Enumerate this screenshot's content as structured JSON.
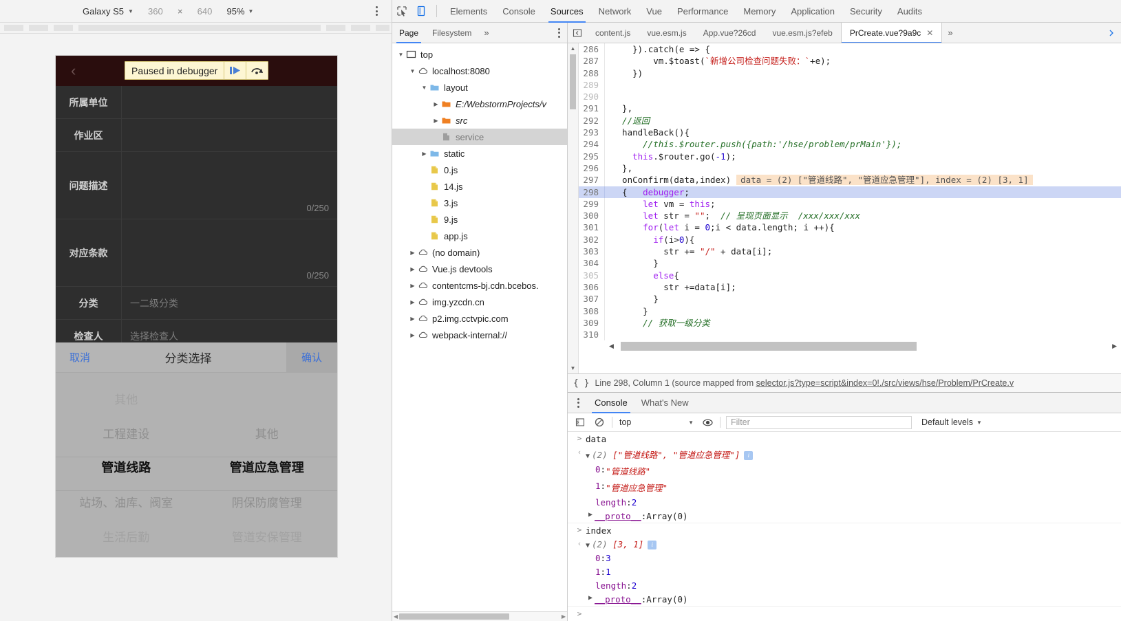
{
  "device_toolbar": {
    "device_name": "Galaxy S5",
    "width": "360",
    "dim_separator": "×",
    "height": "640",
    "zoom": "95%",
    "more_options_icon": "kebab-menu-icon"
  },
  "phone": {
    "back_icon": "back-chevron-icon",
    "paused_banner": {
      "text": "Paused in debugger",
      "resume_icon": "resume-script-icon",
      "step_over_icon": "step-over-icon"
    },
    "form_rows": [
      {
        "label": "所属单位",
        "value": "",
        "counter": ""
      },
      {
        "label": "作业区",
        "value": "",
        "counter": ""
      },
      {
        "label": "问题描述",
        "value": "",
        "counter": "0/250"
      },
      {
        "label": "对应条款",
        "value": "",
        "counter": "0/250"
      },
      {
        "label": "分类",
        "value": "一二级分类",
        "counter": ""
      },
      {
        "label": "检查人",
        "value": "选择检查人",
        "counter": ""
      }
    ],
    "picker": {
      "cancel": "取消",
      "title": "分类选择",
      "confirm": "确认",
      "column_left": [
        {
          "text": "其他",
          "state": "faded"
        },
        {
          "text": "工程建设",
          "state": "normal"
        },
        {
          "text": "管道线路",
          "state": "selected"
        },
        {
          "text": "站场、油库、阀室",
          "state": "normal"
        },
        {
          "text": "生活后勤",
          "state": "faded"
        }
      ],
      "column_right": [
        {
          "text": "",
          "state": "faded"
        },
        {
          "text": "其他",
          "state": "normal"
        },
        {
          "text": "管道应急管理",
          "state": "selected"
        },
        {
          "text": "阴保防腐管理",
          "state": "normal"
        },
        {
          "text": "管道安保管理",
          "state": "faded"
        }
      ]
    }
  },
  "devtools": {
    "inspect_icon": "inspect-element-icon",
    "device_toggle_icon": "toggle-device-toolbar-icon",
    "tabs": [
      {
        "label": "Elements",
        "active": false
      },
      {
        "label": "Console",
        "active": false
      },
      {
        "label": "Sources",
        "active": true
      },
      {
        "label": "Network",
        "active": false
      },
      {
        "label": "Vue",
        "active": false
      },
      {
        "label": "Performance",
        "active": false
      },
      {
        "label": "Memory",
        "active": false
      },
      {
        "label": "Application",
        "active": false
      },
      {
        "label": "Security",
        "active": false
      },
      {
        "label": "Audits",
        "active": false
      }
    ]
  },
  "navigator": {
    "tabs": [
      {
        "label": "Page",
        "active": true
      },
      {
        "label": "Filesystem",
        "active": false
      }
    ],
    "more_icon": "more-tabs-chevron-icon",
    "kebab_icon": "navigator-menu-icon",
    "tree": [
      {
        "indent": 0,
        "twisty": "▼",
        "icon": "frame-icon",
        "label": "top",
        "style": "normal",
        "selected": false
      },
      {
        "indent": 1,
        "twisty": "▼",
        "icon": "cloud-icon",
        "label": "localhost:8080",
        "style": "normal",
        "selected": false
      },
      {
        "indent": 2,
        "twisty": "▼",
        "icon": "folder-blue-icon",
        "label": "layout",
        "style": "normal",
        "selected": false
      },
      {
        "indent": 3,
        "twisty": "▶",
        "icon": "folder-orange-icon",
        "label": "E:/WebstormProjects/v",
        "style": "italic",
        "selected": false
      },
      {
        "indent": 3,
        "twisty": "▶",
        "icon": "folder-orange-icon",
        "label": "src",
        "style": "italic",
        "selected": false
      },
      {
        "indent": 3,
        "twisty": "",
        "icon": "file-gray-icon",
        "label": "service",
        "style": "dim",
        "selected": true
      },
      {
        "indent": 2,
        "twisty": "▶",
        "icon": "folder-blue-icon",
        "label": "static",
        "style": "normal",
        "selected": false
      },
      {
        "indent": 2,
        "twisty": "",
        "icon": "file-js-icon",
        "label": "0.js",
        "style": "normal",
        "selected": false
      },
      {
        "indent": 2,
        "twisty": "",
        "icon": "file-js-icon",
        "label": "14.js",
        "style": "normal",
        "selected": false
      },
      {
        "indent": 2,
        "twisty": "",
        "icon": "file-js-icon",
        "label": "3.js",
        "style": "normal",
        "selected": false
      },
      {
        "indent": 2,
        "twisty": "",
        "icon": "file-js-icon",
        "label": "9.js",
        "style": "normal",
        "selected": false
      },
      {
        "indent": 2,
        "twisty": "",
        "icon": "file-js-icon",
        "label": "app.js",
        "style": "normal",
        "selected": false
      },
      {
        "indent": 1,
        "twisty": "▶",
        "icon": "cloud-icon",
        "label": "(no domain)",
        "style": "normal",
        "selected": false
      },
      {
        "indent": 1,
        "twisty": "▶",
        "icon": "cloud-icon",
        "label": "Vue.js devtools",
        "style": "normal",
        "selected": false
      },
      {
        "indent": 1,
        "twisty": "▶",
        "icon": "cloud-icon",
        "label": "contentcms-bj.cdn.bcebos.",
        "style": "normal",
        "selected": false
      },
      {
        "indent": 1,
        "twisty": "▶",
        "icon": "cloud-icon",
        "label": "img.yzcdn.cn",
        "style": "normal",
        "selected": false
      },
      {
        "indent": 1,
        "twisty": "▶",
        "icon": "cloud-icon",
        "label": "p2.img.cctvpic.com",
        "style": "normal",
        "selected": false
      },
      {
        "indent": 1,
        "twisty": "▶",
        "icon": "cloud-icon",
        "label": "webpack-internal://",
        "style": "normal",
        "selected": false
      }
    ]
  },
  "file_tabs": {
    "panel_icon": "show-navigator-icon",
    "items": [
      {
        "label": "content.js",
        "active": false,
        "closable": false
      },
      {
        "label": "vue.esm.js",
        "active": false,
        "closable": false
      },
      {
        "label": "App.vue?26cd",
        "active": false,
        "closable": false
      },
      {
        "label": "vue.esm.js?efeb",
        "active": false,
        "closable": false
      },
      {
        "label": "PrCreate.vue?9a9c",
        "active": true,
        "closable": true
      }
    ],
    "close_icon": "close-tab-icon",
    "overflow_icon": "more-tabs-icon"
  },
  "editor": {
    "inline_value": "data = (2) [\"管道线路\", \"管道应急管理\"], index = (2) [3, 1]",
    "lines": [
      {
        "num": "286",
        "dim": false,
        "hl": false,
        "tokens": [
          {
            "t": "p",
            "v": "    })."
          },
          {
            "t": "f",
            "v": "catch"
          },
          {
            "t": "p",
            "v": "(e => {"
          }
        ]
      },
      {
        "num": "287",
        "dim": false,
        "hl": false,
        "tokens": [
          {
            "t": "p",
            "v": "        vm."
          },
          {
            "t": "f",
            "v": "$toast"
          },
          {
            "t": "p",
            "v": "("
          },
          {
            "t": "s",
            "v": "`新增公司检查问题失败：`"
          },
          {
            "t": "p",
            "v": "+e);"
          }
        ]
      },
      {
        "num": "288",
        "dim": false,
        "hl": false,
        "tokens": [
          {
            "t": "p",
            "v": "    })"
          }
        ]
      },
      {
        "num": "289",
        "dim": true,
        "hl": false,
        "tokens": []
      },
      {
        "num": "290",
        "dim": true,
        "hl": false,
        "tokens": []
      },
      {
        "num": "291",
        "dim": false,
        "hl": false,
        "tokens": [
          {
            "t": "p",
            "v": "  },"
          }
        ]
      },
      {
        "num": "292",
        "dim": false,
        "hl": false,
        "tokens": [
          {
            "t": "c",
            "v": "  //返回"
          }
        ]
      },
      {
        "num": "293",
        "dim": false,
        "hl": false,
        "tokens": [
          {
            "t": "f",
            "v": "  handleBack"
          },
          {
            "t": "p",
            "v": "(){"
          }
        ]
      },
      {
        "num": "294",
        "dim": false,
        "hl": false,
        "tokens": [
          {
            "t": "c",
            "v": "      //this.$router.push({path:'/hse/problem/prMain'});"
          }
        ]
      },
      {
        "num": "295",
        "dim": false,
        "hl": false,
        "tokens": [
          {
            "t": "k",
            "v": "    this"
          },
          {
            "t": "p",
            "v": ".$router."
          },
          {
            "t": "f",
            "v": "go"
          },
          {
            "t": "p",
            "v": "("
          },
          {
            "t": "n",
            "v": "-1"
          },
          {
            "t": "p",
            "v": ");"
          }
        ]
      },
      {
        "num": "296",
        "dim": false,
        "hl": false,
        "tokens": [
          {
            "t": "p",
            "v": "  },"
          }
        ]
      },
      {
        "num": "297",
        "dim": false,
        "hl": false,
        "inline": true,
        "tokens": [
          {
            "t": "f",
            "v": "  onConfirm"
          },
          {
            "t": "p",
            "v": "(data,index)"
          }
        ]
      },
      {
        "num": "298",
        "dim": false,
        "hl": true,
        "tokens": [
          {
            "t": "p",
            "v": "  {   "
          },
          {
            "t": "k",
            "v": "debugger"
          },
          {
            "t": "p",
            "v": ";"
          }
        ]
      },
      {
        "num": "299",
        "dim": false,
        "hl": false,
        "tokens": [
          {
            "t": "k",
            "v": "      let"
          },
          {
            "t": "p",
            "v": " vm = "
          },
          {
            "t": "k",
            "v": "this"
          },
          {
            "t": "p",
            "v": ";"
          }
        ]
      },
      {
        "num": "300",
        "dim": false,
        "hl": false,
        "tokens": [
          {
            "t": "k",
            "v": "      let"
          },
          {
            "t": "p",
            "v": " str = "
          },
          {
            "t": "s",
            "v": "\"\""
          },
          {
            "t": "p",
            "v": ";  "
          },
          {
            "t": "c",
            "v": "// 呈现页面显示  /xxx/xxx/xxx"
          }
        ]
      },
      {
        "num": "301",
        "dim": false,
        "hl": false,
        "tokens": [
          {
            "t": "k",
            "v": "      for"
          },
          {
            "t": "p",
            "v": "("
          },
          {
            "t": "k",
            "v": "let"
          },
          {
            "t": "p",
            "v": " i = "
          },
          {
            "t": "n",
            "v": "0"
          },
          {
            "t": "p",
            "v": ";i < data.length; i ++){"
          }
        ]
      },
      {
        "num": "302",
        "dim": false,
        "hl": false,
        "tokens": [
          {
            "t": "k",
            "v": "        if"
          },
          {
            "t": "p",
            "v": "(i>"
          },
          {
            "t": "n",
            "v": "0"
          },
          {
            "t": "p",
            "v": "){"
          }
        ]
      },
      {
        "num": "303",
        "dim": false,
        "hl": false,
        "tokens": [
          {
            "t": "p",
            "v": "          str += "
          },
          {
            "t": "s",
            "v": "\"/\""
          },
          {
            "t": "p",
            "v": " + data[i];"
          }
        ]
      },
      {
        "num": "304",
        "dim": false,
        "hl": false,
        "tokens": [
          {
            "t": "p",
            "v": "        }"
          }
        ]
      },
      {
        "num": "305",
        "dim": true,
        "hl": false,
        "tokens": [
          {
            "t": "k",
            "v": "        else"
          },
          {
            "t": "p",
            "v": "{"
          }
        ]
      },
      {
        "num": "306",
        "dim": false,
        "hl": false,
        "tokens": [
          {
            "t": "p",
            "v": "          str +=data[i];"
          }
        ]
      },
      {
        "num": "307",
        "dim": false,
        "hl": false,
        "tokens": [
          {
            "t": "p",
            "v": "        }"
          }
        ]
      },
      {
        "num": "308",
        "dim": false,
        "hl": false,
        "tokens": [
          {
            "t": "p",
            "v": "      }"
          }
        ]
      },
      {
        "num": "309",
        "dim": false,
        "hl": false,
        "tokens": [
          {
            "t": "c",
            "v": "      // 获取一级分类"
          }
        ]
      },
      {
        "num": "310",
        "dim": false,
        "hl": false,
        "tokens": []
      }
    ],
    "scroll_left_icon": "scroll-left-icon",
    "scroll_right_icon": "scroll-right-icon"
  },
  "status": {
    "format_icon": "pretty-print-braces-icon",
    "text_before": "Line 298, Column 1 (source mapped from ",
    "link": "selector.js?type=script&index=0!./src/views/hse/Problem/PrCreate.v"
  },
  "drawer": {
    "kebab_icon": "drawer-menu-icon",
    "tabs": [
      {
        "label": "Console",
        "active": true
      },
      {
        "label": "What's New",
        "active": false
      }
    ],
    "toolbar": {
      "sidebar_icon": "console-sidebar-icon",
      "clear_icon": "clear-console-icon",
      "context": "top",
      "eye_icon": "live-expression-icon",
      "filter_placeholder": "Filter",
      "levels": "Default levels"
    },
    "entries": [
      {
        "kind": "input",
        "arrow": "input-arrow-icon",
        "text": "data"
      },
      {
        "kind": "output",
        "arrow": "output-arrow-icon",
        "expand": "▼",
        "count": "(2)",
        "preview": "[\"管道线路\", \"管道应急管理\"]",
        "info": "i",
        "props": [
          {
            "key": "0",
            "val": "\"管道线路\"",
            "valtype": "string"
          },
          {
            "key": "1",
            "val": "\"管道应急管理\"",
            "valtype": "string"
          },
          {
            "key": "length",
            "val": "2",
            "valtype": "number"
          },
          {
            "key": "__proto__",
            "val": "Array(0)",
            "valtype": "object",
            "twisty": "▶"
          }
        ]
      },
      {
        "kind": "input",
        "arrow": "input-arrow-icon",
        "text": "index"
      },
      {
        "kind": "output",
        "arrow": "output-arrow-icon",
        "expand": "▼",
        "count": "(2)",
        "preview": "[3, 1]",
        "info": "i",
        "props": [
          {
            "key": "0",
            "val": "3",
            "valtype": "number"
          },
          {
            "key": "1",
            "val": "1",
            "valtype": "number"
          },
          {
            "key": "length",
            "val": "2",
            "valtype": "number"
          },
          {
            "key": "__proto__",
            "val": "Array(0)",
            "valtype": "object",
            "twisty": "▶"
          }
        ]
      }
    ],
    "prompt_icon": "console-prompt-icon"
  }
}
